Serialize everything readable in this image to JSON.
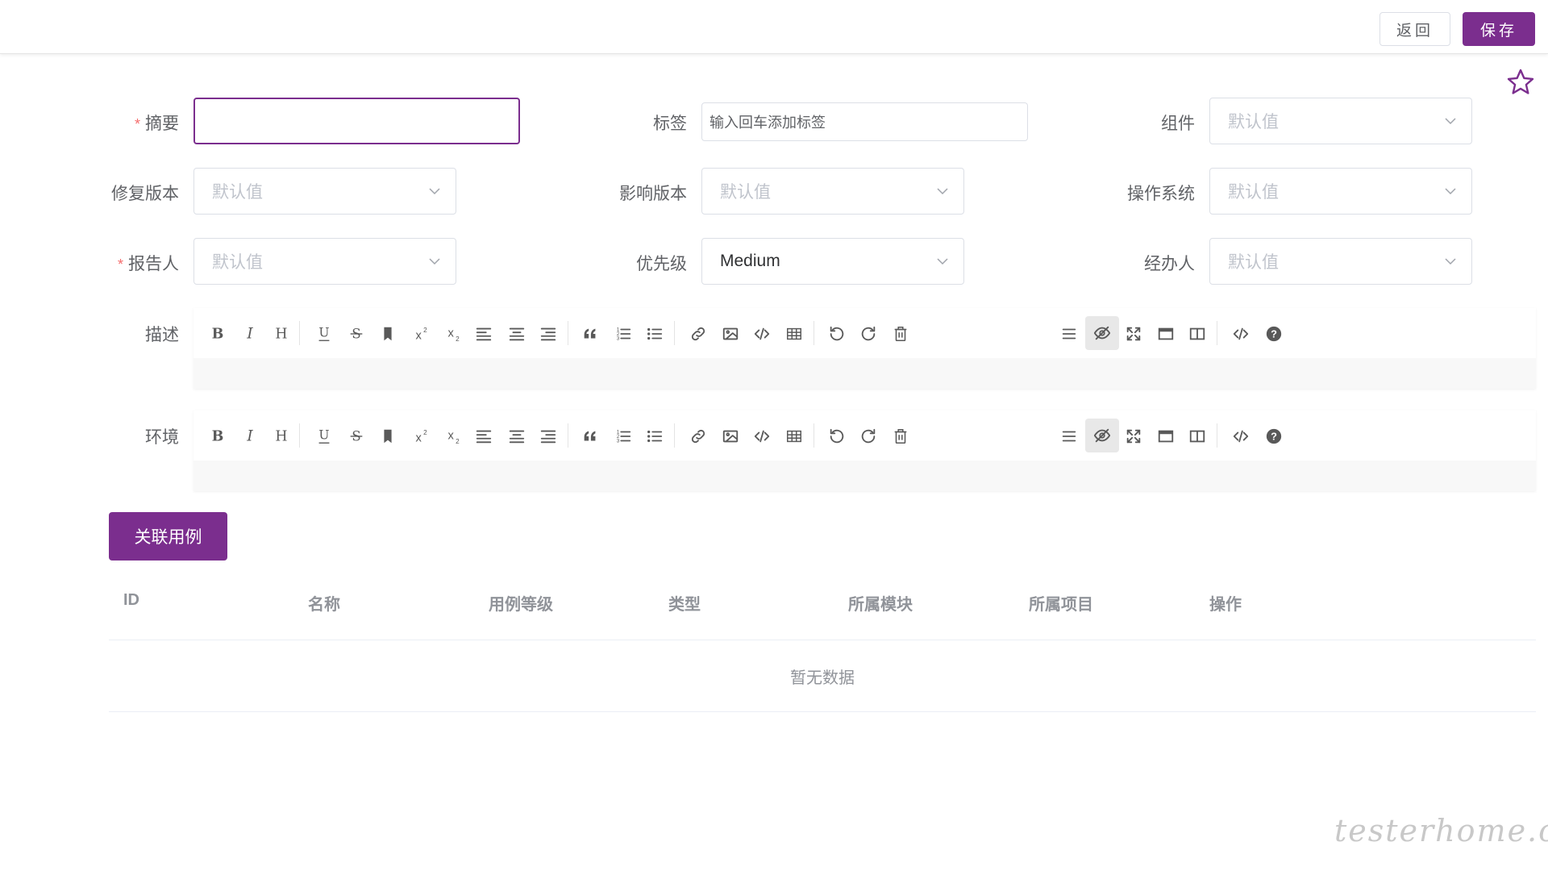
{
  "header": {
    "back_label": "返回",
    "save_label": "保存"
  },
  "form": {
    "summary": {
      "label": "摘要",
      "required": "*",
      "value": ""
    },
    "tags": {
      "label": "标签",
      "placeholder": "输入回车添加标签"
    },
    "component": {
      "label": "组件",
      "placeholder": "默认值"
    },
    "fix_version": {
      "label": "修复版本",
      "placeholder": "默认值"
    },
    "affected_version": {
      "label": "影响版本",
      "placeholder": "默认值"
    },
    "os": {
      "label": "操作系统",
      "placeholder": "默认值"
    },
    "reporter": {
      "label": "报告人",
      "required": "*",
      "placeholder": "默认值"
    },
    "priority": {
      "label": "优先级",
      "value": "Medium"
    },
    "assignee": {
      "label": "经办人",
      "placeholder": "默认值"
    },
    "description": {
      "label": "描述"
    },
    "environment": {
      "label": "环境"
    }
  },
  "related_cases": {
    "button_label": "关联用例",
    "columns": [
      "ID",
      "名称",
      "用例等级",
      "类型",
      "所属模块",
      "所属项目",
      "操作"
    ],
    "empty_text": "暂无数据"
  },
  "watermark": "testerhome.com",
  "colors": {
    "accent": "#7b2e8e",
    "required": "#f56c6c",
    "placeholder": "#c0c4cc"
  },
  "toolbar_icons": [
    "bold-icon",
    "italic-icon",
    "header-icon",
    "underline-icon",
    "strikethrough-icon",
    "bookmark-icon",
    "superscript-icon",
    "subscript-icon",
    "align-left-icon",
    "align-center-icon",
    "align-right-icon",
    "quote-icon",
    "ordered-list-icon",
    "unordered-list-icon",
    "link-icon",
    "image-icon",
    "code-icon",
    "table-icon",
    "undo-icon",
    "redo-icon",
    "trash-icon",
    "menu-icon",
    "preview-toggle-icon",
    "fullscreen-icon",
    "window-icon",
    "split-view-icon",
    "html-code-icon",
    "help-icon"
  ]
}
